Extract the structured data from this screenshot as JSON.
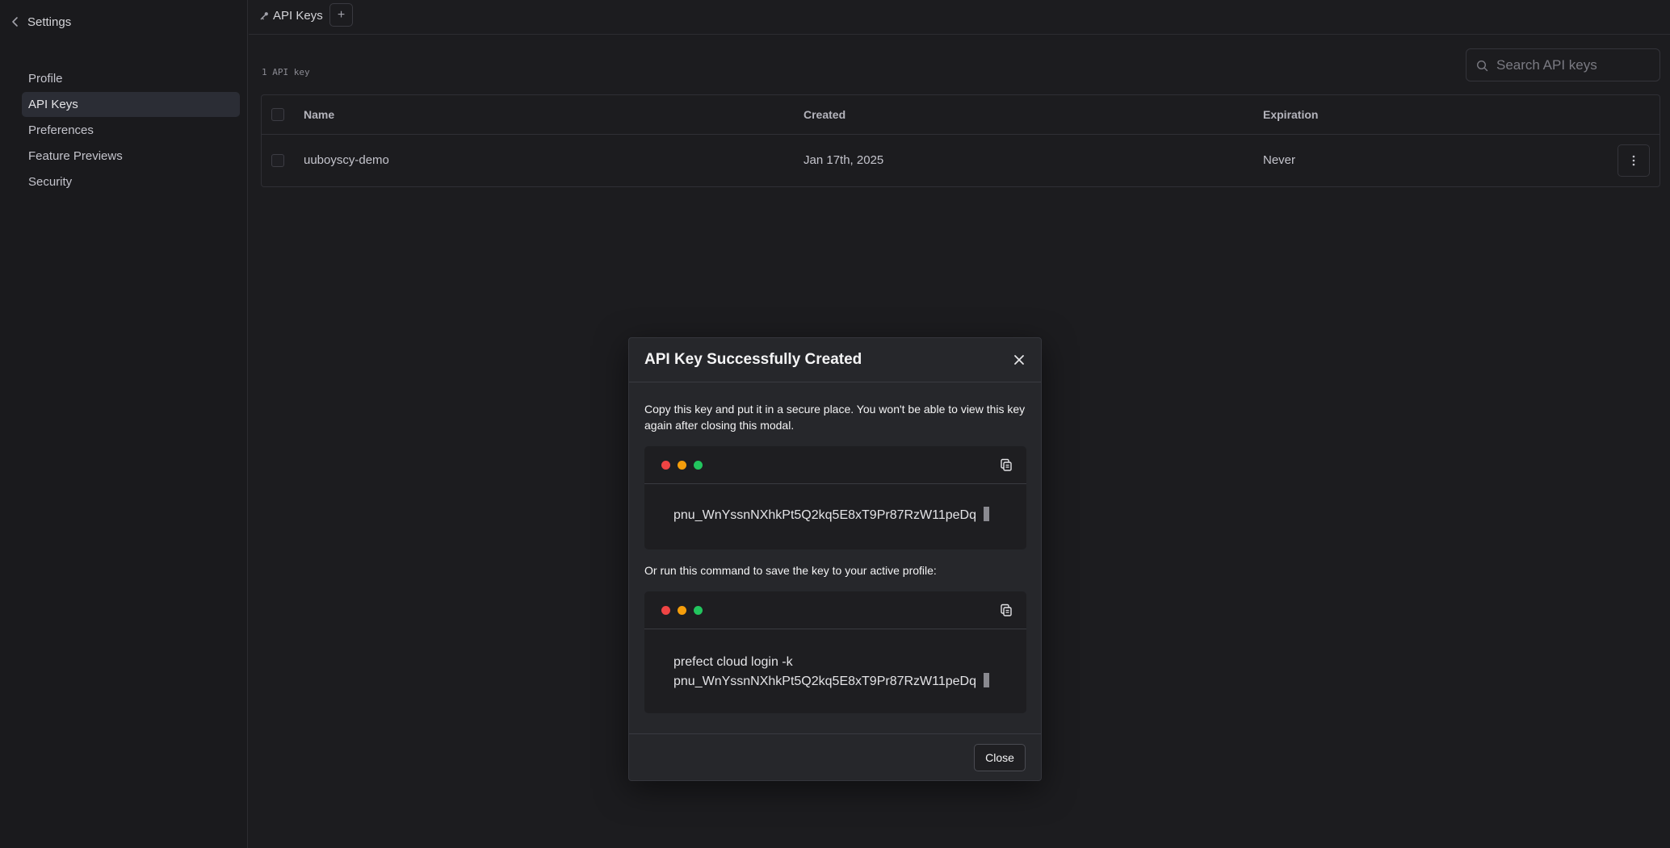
{
  "sidebar": {
    "back_label": "Settings",
    "items": [
      {
        "label": "Profile",
        "active": false
      },
      {
        "label": "API Keys",
        "active": true
      },
      {
        "label": "Preferences",
        "active": false
      },
      {
        "label": "Feature Previews",
        "active": false
      },
      {
        "label": "Security",
        "active": false
      }
    ]
  },
  "topbar": {
    "breadcrumb": "API Keys",
    "add_label": "+"
  },
  "main": {
    "count_label": "1 API key",
    "search": {
      "placeholder": "Search API keys",
      "value": ""
    },
    "table": {
      "headers": {
        "name": "Name",
        "created": "Created",
        "expiration": "Expiration"
      },
      "rows": [
        {
          "name": "uuboyscy-demo",
          "created": "Jan 17th, 2025",
          "expiration": "Never"
        }
      ]
    }
  },
  "modal": {
    "title": "API Key Successfully Created",
    "description": "Copy this key and put it in a secure place. You won't be able to view this key again after closing this modal.",
    "key_code": "pnu_WnYssnNXhkPt5Q2kq5E8xT9Pr87RzW11peDq",
    "command_intro": "Or run this command to save the key to your active profile:",
    "command_line1": "prefect cloud login -k",
    "command_line2": "pnu_WnYssnNXhkPt5Q2kq5E8xT9Pr87RzW11peDq",
    "close_label": "Close"
  },
  "colors": {
    "dot_red": "#ef4444",
    "dot_amber": "#f59e0b",
    "dot_green": "#22c55e",
    "active_nav": "#2b2d35"
  },
  "icons": {
    "back": "chevron-left-icon",
    "breadcrumb": "key-icon",
    "search": "search-icon",
    "kebab": "more-vertical-icon",
    "close": "close-icon",
    "copy": "copy-icon"
  }
}
